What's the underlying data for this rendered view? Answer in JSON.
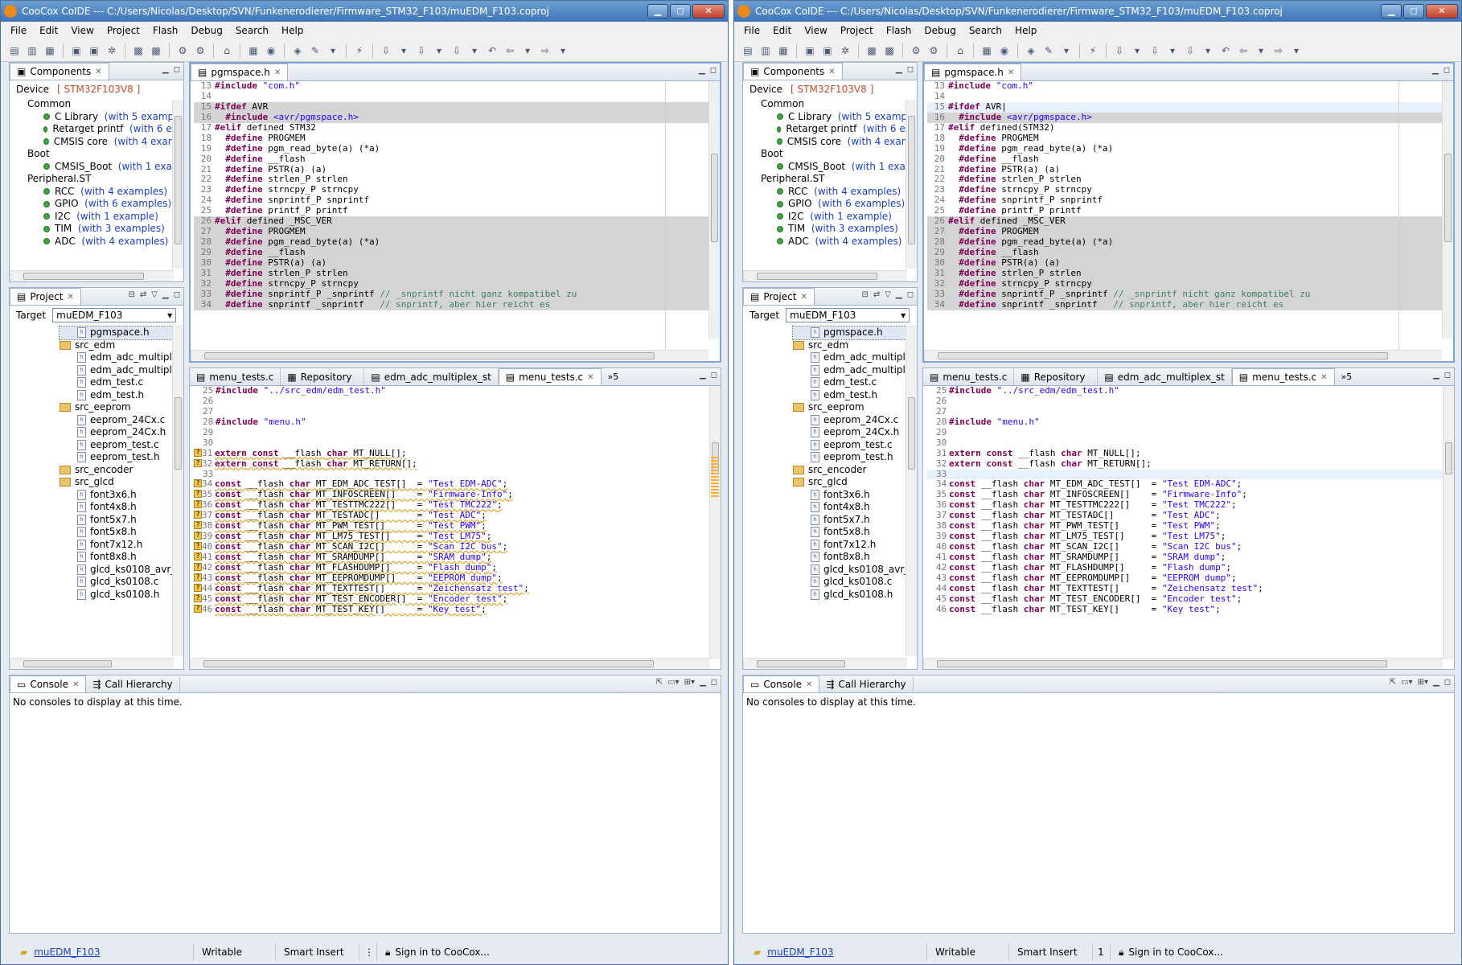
{
  "title": "CooCox CoIDE --- C:/Users/Nicolas/Desktop/SVN/Funkenerodierer/Firmware_STM32_F103/muEDM_F103.coproj",
  "menu": [
    "File",
    "Edit",
    "View",
    "Project",
    "Flash",
    "Debug",
    "Search",
    "Help"
  ],
  "components": {
    "tab": "Components",
    "device_label": "Device",
    "device_value": "[ STM32F103V8 ]",
    "items": [
      {
        "kind": "group",
        "label": "Common"
      },
      {
        "kind": "item",
        "label": "C Library",
        "ex": "(with 5 example"
      },
      {
        "kind": "item",
        "label": "Retarget printf",
        "ex": "(with 6 exa"
      },
      {
        "kind": "item",
        "label": "CMSIS core",
        "ex": "(with 4 examp"
      },
      {
        "kind": "group",
        "label": "Boot"
      },
      {
        "kind": "item",
        "label": "CMSIS_Boot",
        "ex": "(with 1 exam"
      },
      {
        "kind": "group",
        "label": "Peripheral.ST"
      },
      {
        "kind": "item",
        "label": "RCC",
        "ex": "(with 4 examples)"
      },
      {
        "kind": "item",
        "label": "GPIO",
        "ex": "(with 6 examples)"
      },
      {
        "kind": "item",
        "label": "I2C",
        "ex": "(with 1 example)"
      },
      {
        "kind": "item",
        "label": "TIM",
        "ex": "(with 3 examples)"
      },
      {
        "kind": "item",
        "label": "ADC",
        "ex": "(with 4 examples)"
      }
    ]
  },
  "project": {
    "tab": "Project",
    "target_label": "Target",
    "target_value": "muEDM_F103",
    "items": [
      {
        "kind": "file",
        "indent": 1,
        "label": "pgmspace.h",
        "sel": true
      },
      {
        "kind": "folder",
        "indent": 0,
        "label": "src_edm"
      },
      {
        "kind": "file",
        "indent": 1,
        "label": "edm_adc_multiple"
      },
      {
        "kind": "file",
        "indent": 1,
        "label": "edm_adc_multiple"
      },
      {
        "kind": "file",
        "indent": 1,
        "label": "edm_test.c"
      },
      {
        "kind": "file",
        "indent": 1,
        "label": "edm_test.h"
      },
      {
        "kind": "folder",
        "indent": 0,
        "label": "src_eeprom"
      },
      {
        "kind": "file",
        "indent": 1,
        "label": "eeprom_24Cx.c"
      },
      {
        "kind": "file",
        "indent": 1,
        "label": "eeprom_24Cx.h"
      },
      {
        "kind": "file",
        "indent": 1,
        "label": "eeprom_test.c"
      },
      {
        "kind": "file",
        "indent": 1,
        "label": "eeprom_test.h"
      },
      {
        "kind": "folder",
        "indent": 0,
        "label": "src_encoder"
      },
      {
        "kind": "folder",
        "indent": 0,
        "label": "src_glcd"
      },
      {
        "kind": "file",
        "indent": 1,
        "label": "font3x6.h"
      },
      {
        "kind": "file",
        "indent": 1,
        "label": "font4x8.h"
      },
      {
        "kind": "file",
        "indent": 1,
        "label": "font5x7.h"
      },
      {
        "kind": "file",
        "indent": 1,
        "label": "font5x8.h"
      },
      {
        "kind": "file",
        "indent": 1,
        "label": "font7x12.h"
      },
      {
        "kind": "file",
        "indent": 1,
        "label": "font8x8.h"
      },
      {
        "kind": "file",
        "indent": 1,
        "label": "glcd_ks0108_avr_s"
      },
      {
        "kind": "file",
        "indent": 1,
        "label": "glcd_ks0108.c"
      },
      {
        "kind": "file",
        "indent": 1,
        "label": "glcd_ks0108.h"
      }
    ]
  },
  "editor_top": {
    "tab": "pgmspace.h",
    "lines": [
      {
        "n": "13",
        "html": "<span class='pp'>#include</span> <span class='str'>\"com.h\"</span>"
      },
      {
        "n": "14",
        "html": ""
      },
      {
        "n": "15",
        "html": "<span class='pp'>#ifdef</span> AVR",
        "g": 1
      },
      {
        "n": "16",
        "html": "  <span class='pp'>#include</span> <span class='str'>&lt;avr/pgmspace.h&gt;</span>",
        "g": 1
      },
      {
        "n": "17",
        "html": "<span class='pp'>#elif</span> defined STM32"
      },
      {
        "n": "18",
        "html": "  <span class='pp'>#define</span> PROGMEM"
      },
      {
        "n": "19",
        "html": "  <span class='pp'>#define</span> pgm_read_byte(a) (*a)"
      },
      {
        "n": "20",
        "html": "  <span class='pp'>#define</span> __flash"
      },
      {
        "n": "21",
        "html": "  <span class='pp'>#define</span> PSTR(a) (a)"
      },
      {
        "n": "22",
        "html": "  <span class='pp'>#define</span> strlen_P strlen"
      },
      {
        "n": "23",
        "html": "  <span class='pp'>#define</span> strncpy_P strncpy"
      },
      {
        "n": "24",
        "html": "  <span class='pp'>#define</span> snprintf_P snprintf"
      },
      {
        "n": "25",
        "html": "  <span class='pp'>#define</span> printf_P printf"
      },
      {
        "n": "26",
        "html": "<span class='pp'>#elif</span> defined _MSC_VER",
        "g": 1
      },
      {
        "n": "27",
        "html": "  <span class='pp'>#define</span> PROGMEM",
        "g": 1
      },
      {
        "n": "28",
        "html": "  <span class='pp'>#define</span> pgm_read_byte(a) (*a)",
        "g": 1
      },
      {
        "n": "29",
        "html": "  <span class='pp'>#define</span> __flash",
        "g": 1
      },
      {
        "n": "30",
        "html": "  <span class='pp'>#define</span> PSTR(a) (a)",
        "g": 1
      },
      {
        "n": "31",
        "html": "  <span class='pp'>#define</span> strlen_P strlen",
        "g": 1
      },
      {
        "n": "32",
        "html": "  <span class='pp'>#define</span> strncpy_P strncpy",
        "g": 1
      },
      {
        "n": "33",
        "html": "  <span class='pp'>#define</span> snprintf_P _snprintf <span class='cm'>// _snprintf nicht ganz kompatibel zu</span>",
        "g": 1
      },
      {
        "n": "34",
        "html": "  <span class='pp'>#define</span> snprintf _snprintf   <span class='cm'>// snprintf, aber hier reicht es</span>",
        "g": 1
      }
    ]
  },
  "editor_top_right_17": "<span class='pp'>#elif</span> defined(STM32)",
  "editor_top_right_15": "<span class='pp'>#ifdef</span> AVR|",
  "editor_bottom": {
    "tabs": [
      "menu_tests.c",
      "Repository",
      "edm_adc_multiplex_st",
      "menu_tests.c"
    ],
    "more": "»5",
    "lines": [
      {
        "n": "25",
        "html": "<span class='pp'>#include</span> <span class='str'>\"../src_edm/edm_test.h\"</span>"
      },
      {
        "n": "26",
        "html": ""
      },
      {
        "n": "27",
        "html": ""
      },
      {
        "n": "28",
        "html": "<span class='pp'>#include</span> <span class='str'>\"menu.h\"</span>"
      },
      {
        "n": "29",
        "html": ""
      },
      {
        "n": "30",
        "html": ""
      },
      {
        "n": "31",
        "html": "<span class='kw'>extern</span> <span class='kw'>const</span> __flash <span class='kw'>char</span> MT_NULL[];",
        "w": 1
      },
      {
        "n": "32",
        "html": "<span class='kw'>extern</span> <span class='kw'>const</span> __flash <span class='kw'>char</span> MT_RETURN[];",
        "w": 1
      },
      {
        "n": "33",
        "html": ""
      },
      {
        "n": "34",
        "html": "<span class='kw'>const</span> __flash <span class='kw'>char</span> MT_EDM_ADC_TEST[]  = <span class='str'>\"Test EDM-ADC\"</span>;",
        "w": 1
      },
      {
        "n": "35",
        "html": "<span class='kw'>const</span> __flash <span class='kw'>char</span> MT_INFOSCREEN[]    = <span class='str'>\"Firmware-Info\"</span>;",
        "w": 1
      },
      {
        "n": "36",
        "html": "<span class='kw'>const</span> __flash <span class='kw'>char</span> MT_TESTTMC222[]    = <span class='str'>\"Test TMC222\"</span>;",
        "w": 1
      },
      {
        "n": "37",
        "html": "<span class='kw'>const</span> __flash <span class='kw'>char</span> MT_TESTADC[]       = <span class='str'>\"Test ADC\"</span>;",
        "w": 1
      },
      {
        "n": "38",
        "html": "<span class='kw'>const</span> __flash <span class='kw'>char</span> MT_PWM_TEST[]      = <span class='str'>\"Test PWM\"</span>;",
        "w": 1
      },
      {
        "n": "39",
        "html": "<span class='kw'>const</span> __flash <span class='kw'>char</span> MT_LM75_TEST[]     = <span class='str'>\"Test LM75\"</span>;",
        "w": 1
      },
      {
        "n": "40",
        "html": "<span class='kw'>const</span> __flash <span class='kw'>char</span> MT_SCAN_I2C[]      = <span class='str'>\"Scan I2C bus\"</span>;",
        "w": 1
      },
      {
        "n": "41",
        "html": "<span class='kw'>const</span> __flash <span class='kw'>char</span> MT_SRAMDUMP[]      = <span class='str'>\"SRAM dump\"</span>;",
        "w": 1
      },
      {
        "n": "42",
        "html": "<span class='kw'>const</span> __flash <span class='kw'>char</span> MT_FLASHDUMP[]     = <span class='str'>\"Flash dump\"</span>;",
        "w": 1
      },
      {
        "n": "43",
        "html": "<span class='kw'>const</span> __flash <span class='kw'>char</span> MT_EEPROMDUMP[]    = <span class='str'>\"EEPROM dump\"</span>;",
        "w": 1
      },
      {
        "n": "44",
        "html": "<span class='kw'>const</span> __flash <span class='kw'>char</span> MT_TEXTTEST[]      = <span class='str'>\"Zeichensatz test\"</span>;",
        "w": 1
      },
      {
        "n": "45",
        "html": "<span class='kw'>const</span> __flash <span class='kw'>char</span> MT_TEST_ENCODER[]  = <span class='str'>\"Encoder test\"</span>;",
        "w": 1
      },
      {
        "n": "46",
        "html": "<span class='kw'>const</span> __flash <span class='kw'>char</span> MT_TEST_KEY[]      = <span class='str'>\"Key test\"</span>;",
        "w": 1
      }
    ]
  },
  "console": {
    "tabs": [
      "Console",
      "Call Hierarchy"
    ],
    "message": "No consoles to display at this time."
  },
  "status": {
    "project": "muEDM_F103",
    "writable": "Writable",
    "insert": "Smart Insert",
    "left_extra": "⋮",
    "right_extra": "1",
    "signin": "Sign in to CooCox..."
  }
}
